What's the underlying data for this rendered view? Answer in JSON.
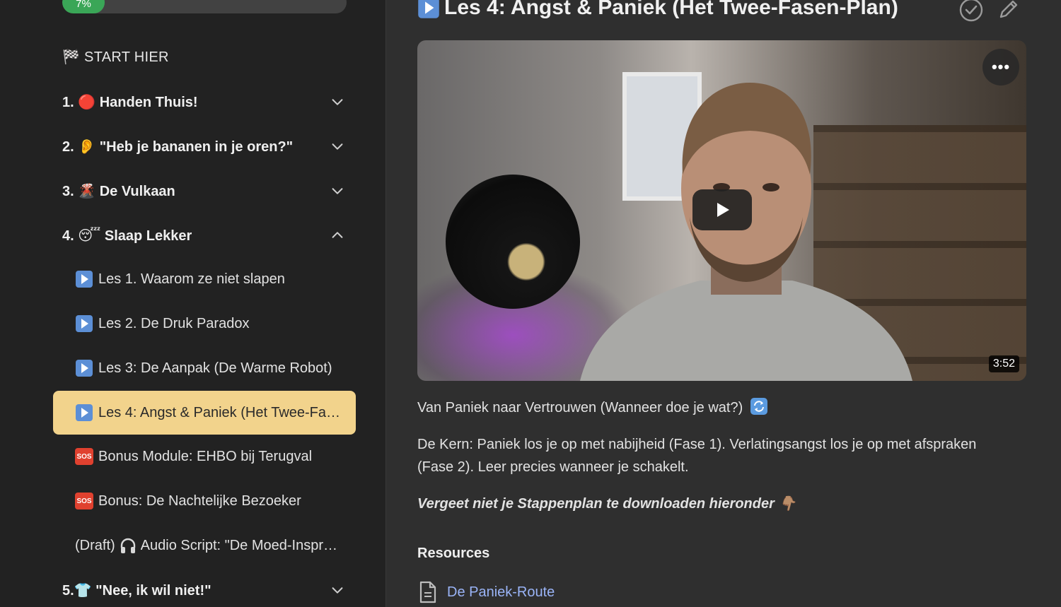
{
  "sidebar": {
    "progress": {
      "label": "7%",
      "value": 0.07
    },
    "start_label": "🏁 START HIER",
    "modules": [
      {
        "label": "1. 🔴 Handen Thuis!",
        "expanded": false
      },
      {
        "label": "2. 👂 \"Heb je bananen in je oren?\"",
        "expanded": false
      },
      {
        "label": "3. 🌋 De Vulkaan",
        "expanded": false
      },
      {
        "label": "4. 😴 Slaap Lekker",
        "expanded": true
      },
      {
        "label": "5.👕 \"Nee, ik wil niet!\"",
        "expanded": false
      }
    ],
    "lessons": [
      {
        "icon": "play",
        "text": "Les 1. Waarom ze niet slapen"
      },
      {
        "icon": "play",
        "text": "Les 2. De Druk Paradox"
      },
      {
        "icon": "play",
        "text": "Les 3: De Aanpak (De Warme Robot)"
      },
      {
        "icon": "play",
        "text": "Les 4: Angst & Paniek (Het Twee-Fa…",
        "active": true
      },
      {
        "icon": "sos",
        "text": "Bonus Module: EHBO bij Terugval"
      },
      {
        "icon": "sos",
        "text": "Bonus: De Nachtelijke Bezoeker"
      },
      {
        "icon": "headphones",
        "prefix": "(Draft)",
        "text": "Audio Script: \"De Moed-Inspr…"
      }
    ],
    "sos_text": "SOS"
  },
  "main": {
    "title": "Les 4: Angst & Paniek (Het Twee-Fasen-Plan)",
    "video": {
      "duration": "3:52",
      "menu": "•••"
    },
    "subtitle": "Van Paniek naar Vertrouwen (Wanneer doe je wat?)",
    "body": "De Kern: Paniek los je op met nabijheid (Fase 1). Verlatingsangst los je op met afspraken (Fase 2). Leer precies wanneer je schakelt.",
    "emphasis": "Vergeet niet je Stappenplan te downloaden hieronder 👇🏽",
    "resources_title": "Resources",
    "resource_link": "De Paniek-Route"
  },
  "colors": {
    "active_lesson_bg": "#f2d38c",
    "progress_fill": "#3aa657",
    "link": "#9ab4f7"
  }
}
